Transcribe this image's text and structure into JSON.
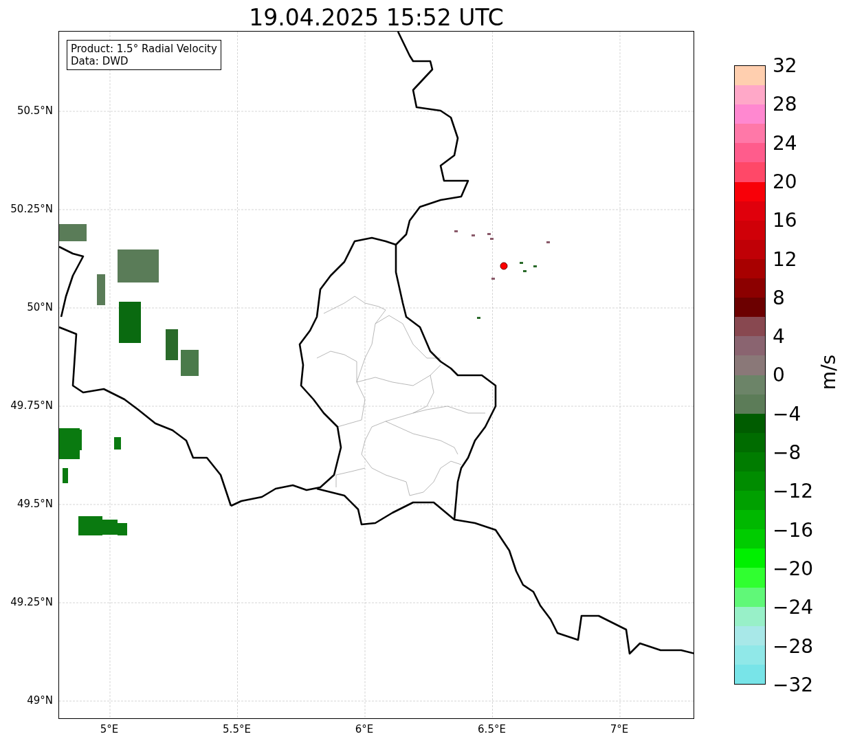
{
  "title": "19.04.2025 15:52 UTC",
  "info_box": {
    "lines": [
      "Product: 1.5° Radial Velocity",
      "Data: DWD"
    ]
  },
  "map": {
    "y_ticks": [
      "50.5°N",
      "50.25°N",
      "50°N",
      "49.75°N",
      "49.5°N",
      "49.25°N",
      "49°N"
    ],
    "x_ticks": [
      "5°E",
      "5.5°E",
      "6°E",
      "6.5°E",
      "7°E"
    ]
  },
  "colorbar": {
    "label": "m/s",
    "ticks": [
      "32",
      "28",
      "24",
      "20",
      "16",
      "12",
      "8",
      "4",
      "0",
      "−4",
      "−8",
      "−12",
      "−16",
      "−20",
      "−24",
      "−28",
      "−32"
    ],
    "bins": [
      {
        "color": "#ffcfaf"
      },
      {
        "color": "#ffa8c8"
      },
      {
        "color": "#ff88d0"
      },
      {
        "color": "#ff78a8"
      },
      {
        "color": "#ff5c8c"
      },
      {
        "color": "#ff4868"
      },
      {
        "color": "#f80008"
      },
      {
        "color": "#e0000c"
      },
      {
        "color": "#d00008"
      },
      {
        "color": "#c00006"
      },
      {
        "color": "#a80000"
      },
      {
        "color": "#8c0000"
      },
      {
        "color": "#6c0000"
      },
      {
        "color": "#884850"
      },
      {
        "color": "#8a6470"
      },
      {
        "color": "#8a7878"
      },
      {
        "color": "#6c8468"
      },
      {
        "color": "#5c7c58"
      },
      {
        "color": "#005c00"
      },
      {
        "color": "#006c00"
      },
      {
        "color": "#007c00"
      },
      {
        "color": "#008c00"
      },
      {
        "color": "#00a000"
      },
      {
        "color": "#00b800"
      },
      {
        "color": "#00cc00"
      },
      {
        "color": "#00f000"
      },
      {
        "color": "#30ff30"
      },
      {
        "color": "#60f878"
      },
      {
        "color": "#98f0c8"
      },
      {
        "color": "#a8e8e8"
      },
      {
        "color": "#90e8e8"
      },
      {
        "color": "#78e4e8"
      }
    ]
  }
}
